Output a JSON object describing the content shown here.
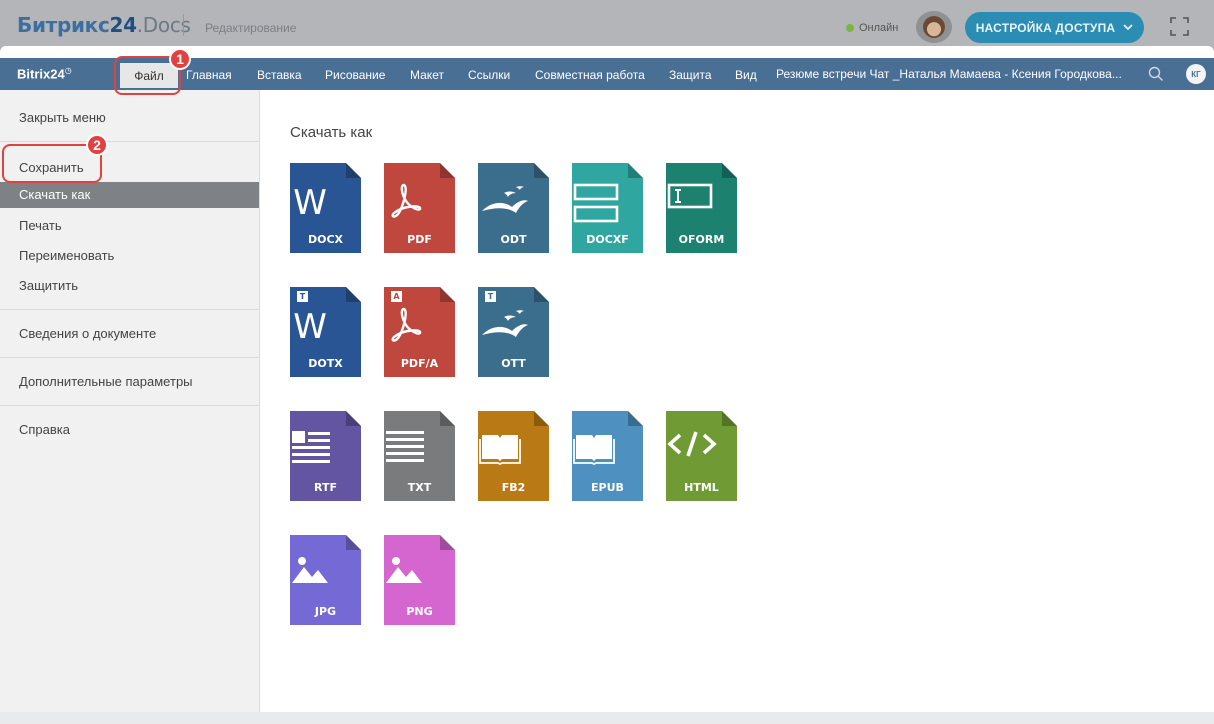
{
  "topbar": {
    "brand_main": "Битрикс",
    "brand_num": "24",
    "brand_docs": ".Docs",
    "mode": "Редактирование",
    "online_label": "Онлайн",
    "access_button": "НАСТРОЙКА ДОСТУПА"
  },
  "menubar": {
    "logo": "Bitrix24",
    "items": [
      "Файл",
      "Главная",
      "Вставка",
      "Рисование",
      "Макет",
      "Ссылки",
      "Совместная работа",
      "Защита",
      "Вид"
    ],
    "doc_title": "Резюме встречи Чат _Наталья Мамаева - Ксения Городкова...",
    "user_initials": "КГ"
  },
  "sidebar": {
    "close_menu": "Закрыть меню",
    "save": "Сохранить",
    "download_as": "Скачать как",
    "print": "Печать",
    "rename": "Переименовать",
    "protect": "Защитить",
    "doc_info": "Сведения о документе",
    "advanced": "Дополнительные параметры",
    "help": "Справка"
  },
  "panel": {
    "title": "Скачать как",
    "formats": [
      {
        "label": "DOCX",
        "color": "#2a5595",
        "icon": "word-icon",
        "badge": ""
      },
      {
        "label": "PDF",
        "color": "#c0473d",
        "icon": "pdf-icon",
        "badge": ""
      },
      {
        "label": "ODT",
        "color": "#3b6d8c",
        "icon": "openoffice-icon",
        "badge": ""
      },
      {
        "label": "DOCXF",
        "color": "#2fa7a0",
        "icon": "form-fields-icon",
        "badge": ""
      },
      {
        "label": "OFORM",
        "color": "#1d8170",
        "icon": "text-field-icon",
        "badge": ""
      },
      {
        "label": "DOTX",
        "color": "#2a5595",
        "icon": "word-icon",
        "badge": "T"
      },
      {
        "label": "PDF/A",
        "color": "#c0473d",
        "icon": "pdf-icon",
        "badge": "A"
      },
      {
        "label": "OTT",
        "color": "#3b6d8c",
        "icon": "openoffice-icon",
        "badge": "T"
      },
      {
        "label": "RTF",
        "color": "#6355a1",
        "icon": "rich-text-icon",
        "badge": ""
      },
      {
        "label": "TXT",
        "color": "#7a7b7d",
        "icon": "plain-text-icon",
        "badge": ""
      },
      {
        "label": "FB2",
        "color": "#b97a16",
        "icon": "book-icon",
        "badge": ""
      },
      {
        "label": "EPUB",
        "color": "#4e90bf",
        "icon": "book-icon",
        "badge": ""
      },
      {
        "label": "HTML",
        "color": "#6f9a34",
        "icon": "code-icon",
        "badge": ""
      },
      {
        "label": "JPG",
        "color": "#7569d5",
        "icon": "image-icon",
        "badge": ""
      },
      {
        "label": "PNG",
        "color": "#d666cf",
        "icon": "image-icon",
        "badge": ""
      }
    ]
  },
  "callouts": [
    "1",
    "2"
  ],
  "colors": {
    "menubar": "#4a6f94",
    "callout": "#e0433f",
    "access_button": "#2b8db3"
  }
}
